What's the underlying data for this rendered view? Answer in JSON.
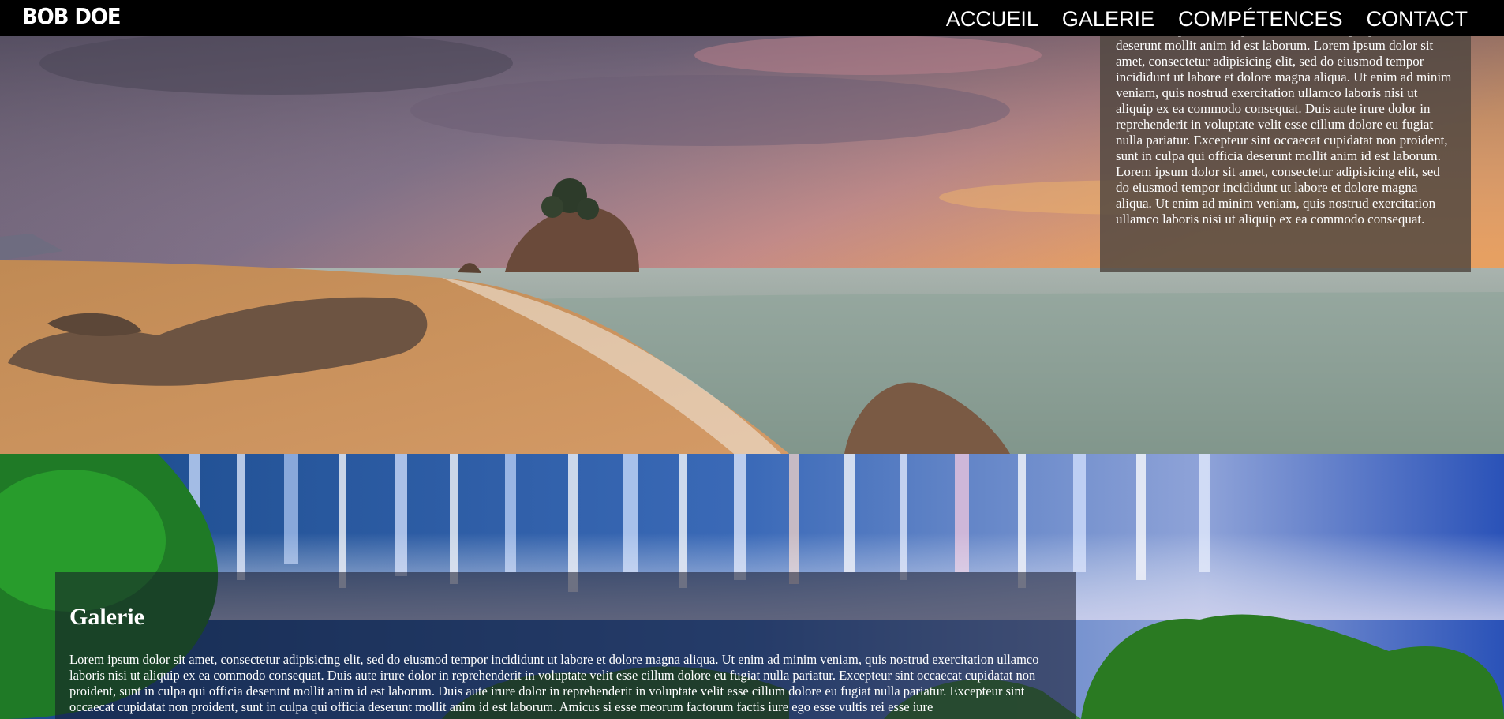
{
  "brand": "BOB DOE",
  "nav": {
    "items": [
      "ACCUEIL",
      "GALERIE",
      "COMPÉTENCES",
      "CONTACT"
    ]
  },
  "about": {
    "text": "occaecat cupidatat non proident, sunt in culpa qui officia deserunt mollit anim id est laborum. Lorem ipsum dolor sit amet, consectetur adipisicing elit, sed do eiusmod tempor incididunt ut labore et dolore magna aliqua. Ut enim ad minim veniam, quis nostrud exercitation ullamco laboris nisi ut aliquip ex ea commodo consequat. Duis aute irure dolor in reprehenderit in voluptate velit esse cillum dolore eu fugiat nulla pariatur. Excepteur sint occaecat cupidatat non proident, sunt in culpa qui officia deserunt mollit anim id est laborum. Lorem ipsum dolor sit amet, consectetur adipisicing elit, sed do eiusmod tempor incididunt ut labore et dolore magna aliqua. Ut enim ad minim veniam, quis nostrud exercitation ullamco laboris nisi ut aliquip ex ea commodo consequat."
  },
  "gallery": {
    "title": "Galerie",
    "text": "Lorem ipsum dolor sit amet, consectetur adipisicing elit, sed do eiusmod tempor incididunt ut labore et dolore magna aliqua. Ut enim ad minim veniam, quis nostrud exercitation ullamco laboris nisi ut aliquip ex ea commodo consequat. Duis aute irure dolor in reprehenderit in voluptate velit esse cillum dolore eu fugiat nulla pariatur. Excepteur sint occaecat cupidatat non proident, sunt in culpa qui officia deserunt mollit anim id est laborum. Duis aute irure dolor in reprehenderit in voluptate velit esse cillum dolore eu fugiat nulla pariatur. Excepteur sint occaecat cupidatat non proident, sunt in culpa qui officia deserunt mollit anim id est laborum. Amicus si esse meorum factorum factis iure ego esse vultis rei esse iure"
  },
  "colors": {
    "nav_bg": "#000000",
    "text": "#ffffff",
    "about_panel": "#4e4640",
    "gallery_panel": "#141628"
  }
}
